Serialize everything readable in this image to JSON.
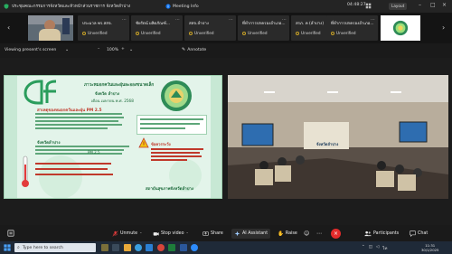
{
  "titlebar": {
    "title": "ประชุมคณะกรรมการจังหวัดและหัวหน้าส่วนราชการ จังหวัดลำปาง",
    "meeting_info": "Meeting Info",
    "timer": "04:48:27",
    "layout_label": "Layout"
  },
  "gallery": {
    "participants": [
      {
        "name": "ประมวล พร.สสจ.",
        "status": "Unverified"
      },
      {
        "name": "ชัยรัตน์ ผลิตภัณฑ์...",
        "status": "Unverified"
      },
      {
        "name": "สสจ.ลำปาง",
        "status": "Unverified"
      },
      {
        "name": "ที่ทำการปกครองอำเภอ...",
        "status": "Unverified"
      },
      {
        "name": "สรภ. ค (ลำปาง)",
        "status": "Unverified"
      },
      {
        "name": "ที่ทำการปกครองอำเภอ...",
        "status": "Unverified"
      }
    ]
  },
  "share": {
    "viewing": "Viewing present's screen",
    "zoom": "100%",
    "annotate": "Annotate"
  },
  "slide": {
    "heading": "ภาวะหมอกควันและฝุ่นละอองขนาดเล็ก",
    "province": "จังหวัด ลำปาง",
    "date": "เดือน เมษายน พ.ศ. 2568",
    "section1": "สาเหตุของหมอกควันและฝุ่น PM 2.5",
    "section2": "จังหวัดลำปาง",
    "warning_title": "ข้อควรระวัง",
    "footer": "สถาบันสุขภาพจังหวัดลำปาง",
    "pm_value": "PM 2.5"
  },
  "room": {
    "sign": "จังหวัดลำปาง"
  },
  "toolbar": {
    "unmute": "Unmute",
    "stop_video": "Stop video",
    "share": "Share",
    "ai_assistant": "AI Assistant",
    "raise": "Raise",
    "participants": "Participants",
    "chat": "Chat"
  },
  "taskbar": {
    "search_placeholder": "Type here to search",
    "time": "11:31",
    "date": "30/1/2025"
  },
  "colors": {
    "unmute_red": "#e23b3b",
    "end_red": "#e32b2b",
    "unverified": "#c9a227"
  }
}
